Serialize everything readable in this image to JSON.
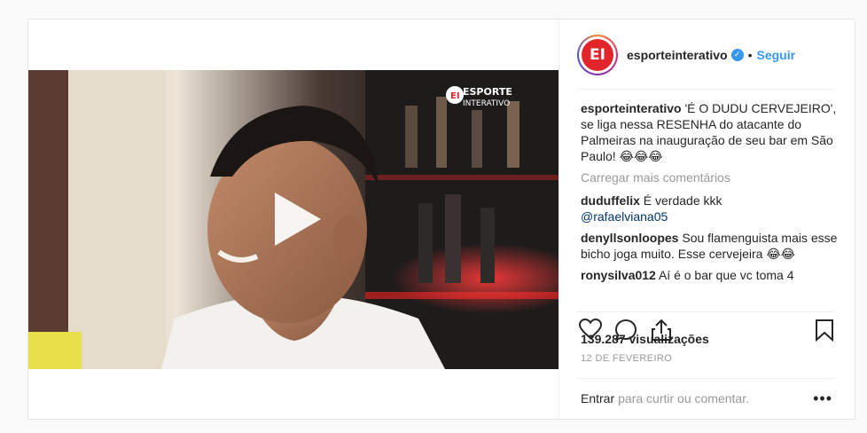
{
  "post": {
    "username": "esporteinterativo",
    "avatar_text": "EI",
    "follow_label": "Seguir",
    "separator": "•",
    "watermark_line1": "ESPORTE",
    "watermark_line2": "INTERATIVO"
  },
  "caption": {
    "username": "esporteinterativo",
    "text": " 'É O DUDU CERVEJEIRO', se liga nessa RESENHA do atacante do Palmeiras na inauguração de seu bar em São Paulo! 😂😂😂"
  },
  "load_more_label": "Carregar mais comentários",
  "comments": [
    {
      "username": "duduffelix",
      "text": " É verdade kkk",
      "mention": "@rafaelviana05"
    },
    {
      "username": "denyllsonloopes",
      "text": " Sou flamenguista mais esse bicho joga muito. Esse cervejeira 😂😂"
    },
    {
      "username": "ronysilva012",
      "text": " Aí é o bar que vc toma 4"
    }
  ],
  "stats": {
    "views": "139.287 visualizações",
    "date": "12 DE FEVEREIRO"
  },
  "footer": {
    "login_label": "Entrar",
    "rest": "para curtir ou comentar.",
    "options": "•••"
  },
  "icons": {
    "like": "heart-icon",
    "comment": "comment-icon",
    "share": "share-icon",
    "save": "bookmark-icon",
    "play": "play-icon"
  },
  "colors": {
    "accent": "#3897f0",
    "brand_red": "#e2242b",
    "muted": "#999999"
  }
}
